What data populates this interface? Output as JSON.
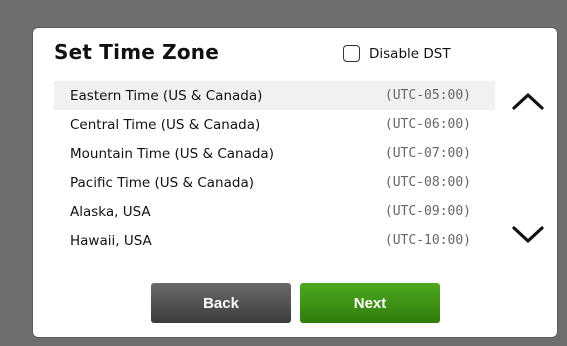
{
  "dialog": {
    "title": "Set Time Zone",
    "disable_dst": {
      "label": "Disable DST",
      "checked": false
    },
    "time_zones": [
      {
        "name": "Eastern Time (US & Canada)",
        "offset": "(UTC-05:00)",
        "selected": true
      },
      {
        "name": "Central Time (US & Canada)",
        "offset": "(UTC-06:00)",
        "selected": false
      },
      {
        "name": "Mountain Time (US & Canada)",
        "offset": "(UTC-07:00)",
        "selected": false
      },
      {
        "name": "Pacific Time (US & Canada)",
        "offset": "(UTC-08:00)",
        "selected": false
      },
      {
        "name": "Alaska, USA",
        "offset": "(UTC-09:00)",
        "selected": false
      },
      {
        "name": "Hawaii, USA",
        "offset": "(UTC-10:00)",
        "selected": false
      }
    ],
    "scroll_up_icon": "chevron-up-icon",
    "scroll_down_icon": "chevron-down-icon",
    "buttons": {
      "back_label": "Back",
      "next_label": "Next"
    }
  },
  "colors": {
    "backdrop": "#6e6e6e",
    "selected_row": "#f3f0f2",
    "back_button": "#4a4a4a",
    "next_button": "#3e9415"
  }
}
